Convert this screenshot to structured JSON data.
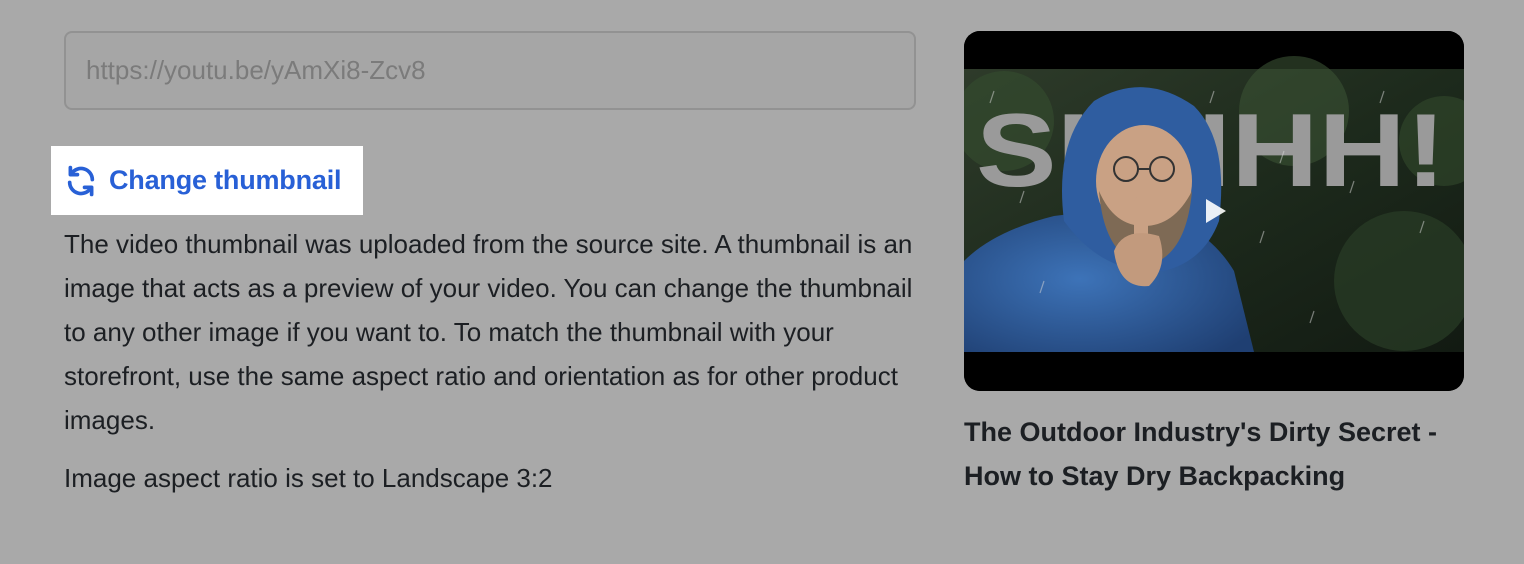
{
  "url_input": {
    "placeholder": "https://youtu.be/yAmXi8-Zcv8",
    "value": ""
  },
  "change_thumbnail": {
    "label": "Change thumbnail",
    "icon": "refresh-icon",
    "color": "#2860d6"
  },
  "description": "The video thumbnail was uploaded from the source site. A thumbnail is an image that acts as a preview of your video. You can change the thumbnail to any other image if you want to. To match the thumbnail with your storefront, use the same aspect ratio and orientation as for other product images.",
  "aspect_ratio_note": "Image aspect ratio is set to Landscape 3:2",
  "video": {
    "thumbnail_text": "SHHHH!",
    "play_icon": "play-icon",
    "title": "The Outdoor Industry's Dirty Secret - How to Stay Dry Backpacking"
  }
}
